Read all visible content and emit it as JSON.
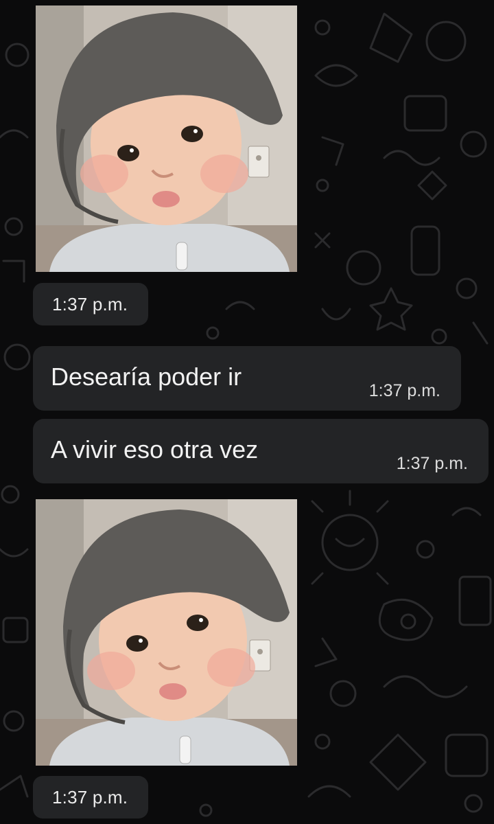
{
  "chat": {
    "messages": [
      {
        "type": "image",
        "media": "baby-photo",
        "time": "1:37 p.m."
      },
      {
        "type": "text",
        "text": "Desearía poder ir",
        "time": "1:37 p.m."
      },
      {
        "type": "text",
        "text": "A vivir eso otra vez",
        "time": "1:37 p.m."
      },
      {
        "type": "image",
        "media": "baby-photo",
        "time": "1:37 p.m."
      }
    ]
  },
  "colors": {
    "background": "#0b0b0c",
    "bubble": "#232426",
    "text": "#f2f2f2",
    "doodle": "#2a2a2c"
  }
}
